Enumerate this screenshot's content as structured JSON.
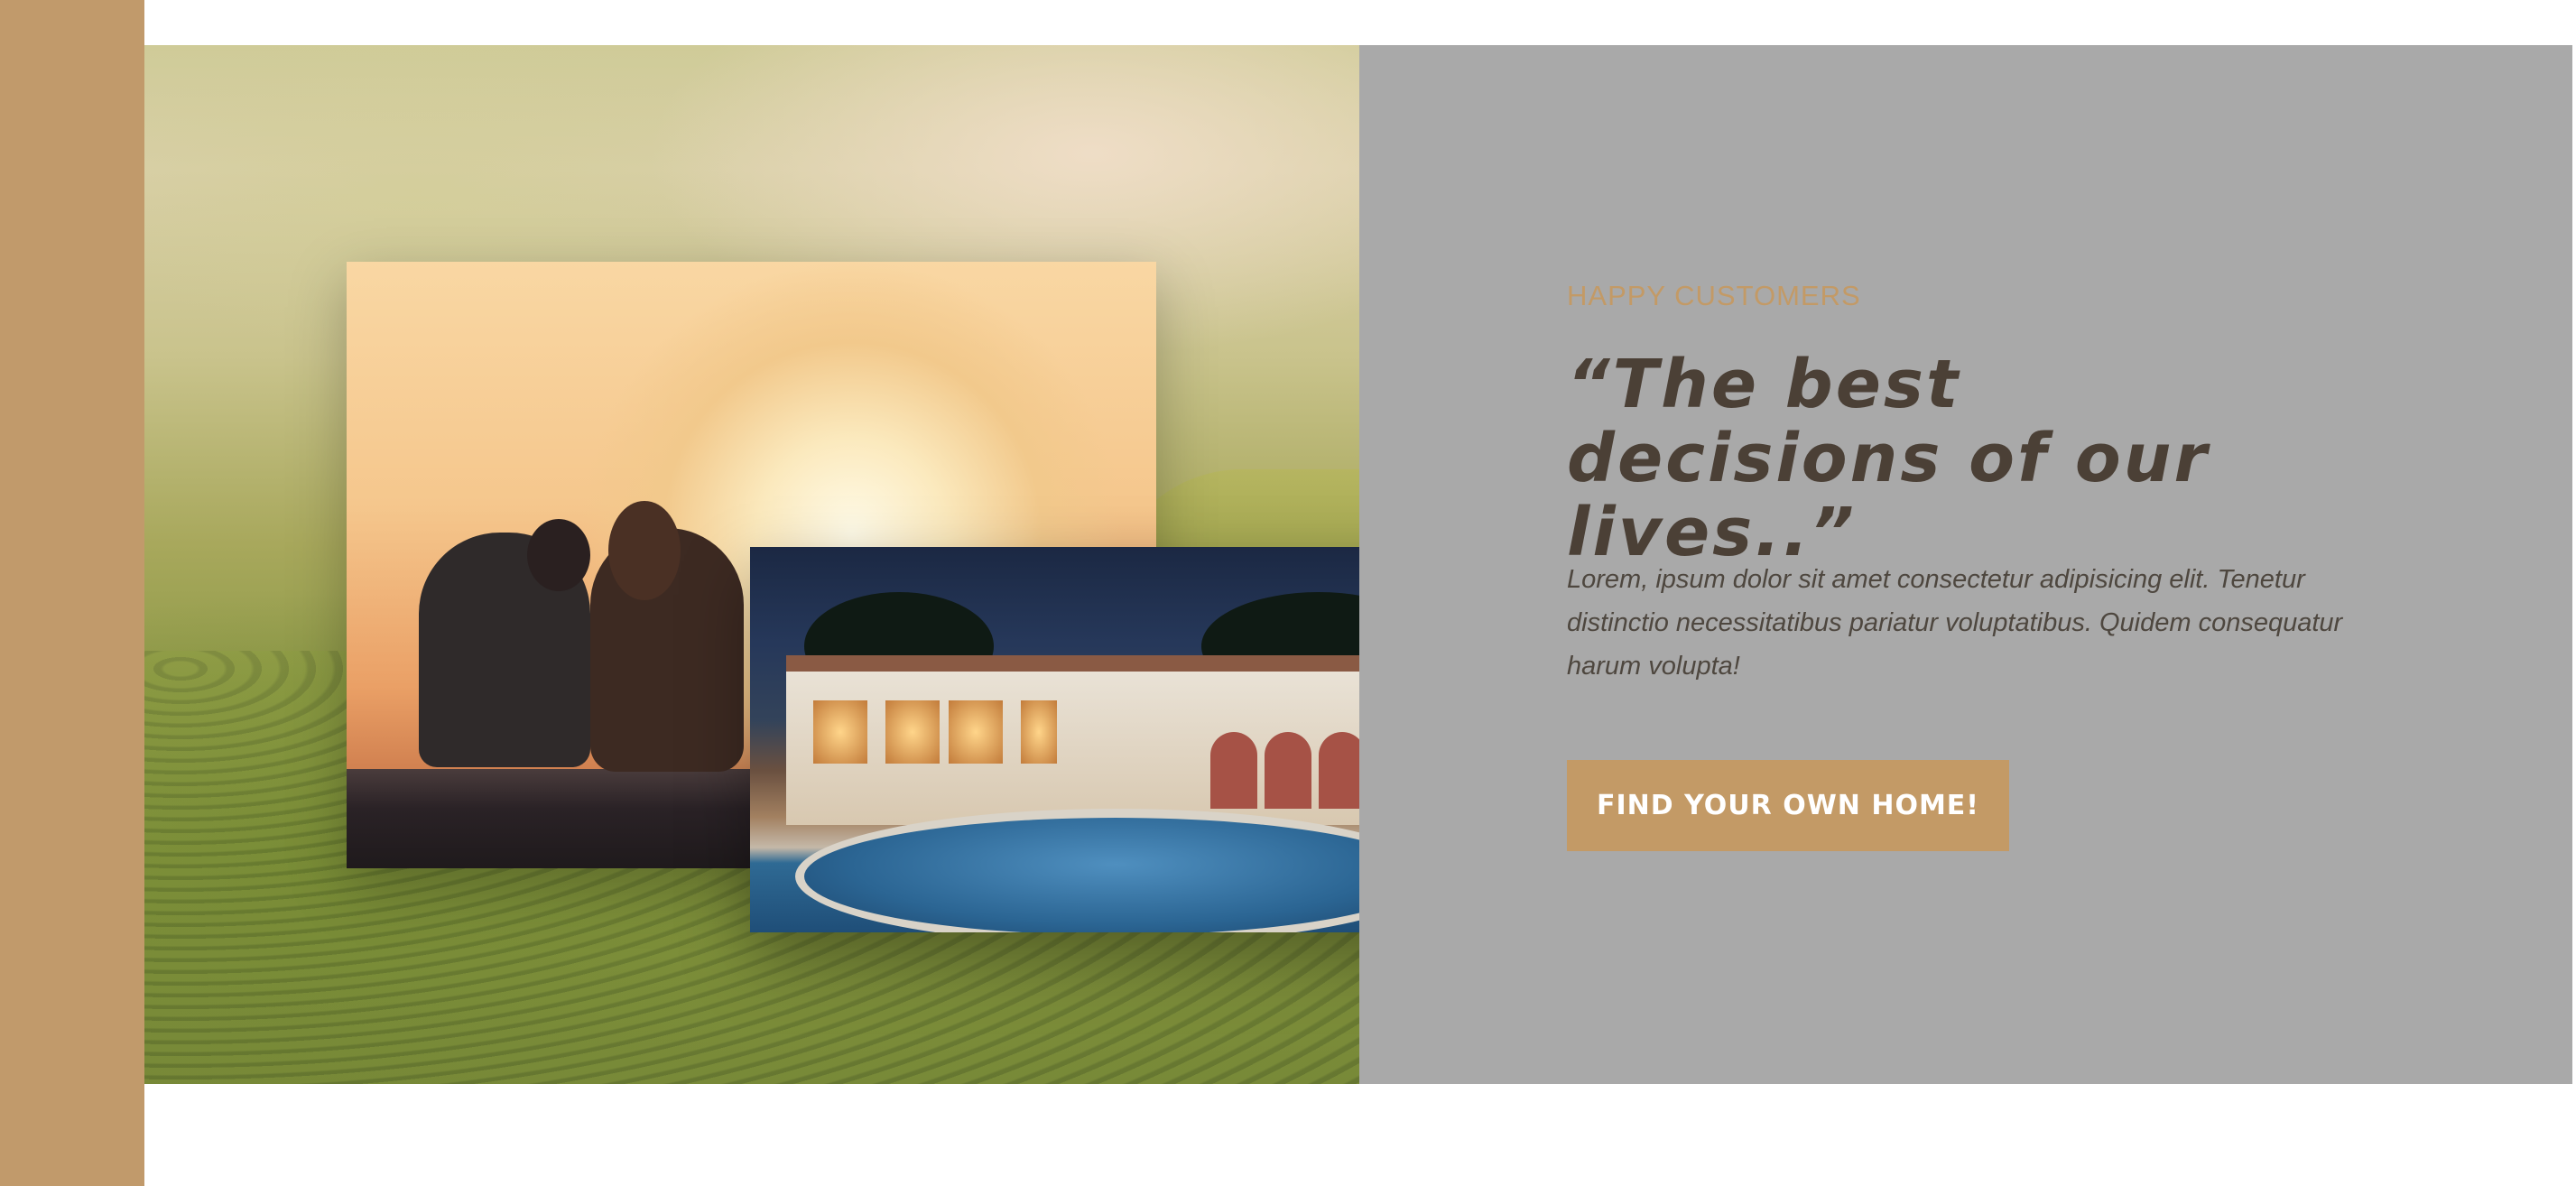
{
  "testimonial": {
    "eyebrow": "HAPPY CUSTOMERS",
    "quote": "“The best decisions of our lives..”",
    "body": "Lorem, ipsum dolor sit amet consectetur adipisicing elit. Tenetur distinctio necessitatibus pariatur voluptatibus. Quidem consequatur harum volupta!",
    "cta_label": "FIND YOUR OWN HOME!"
  },
  "colors": {
    "accent": "#c19a6b",
    "panel": "#a9a9a9",
    "heading": "#4b4036"
  }
}
